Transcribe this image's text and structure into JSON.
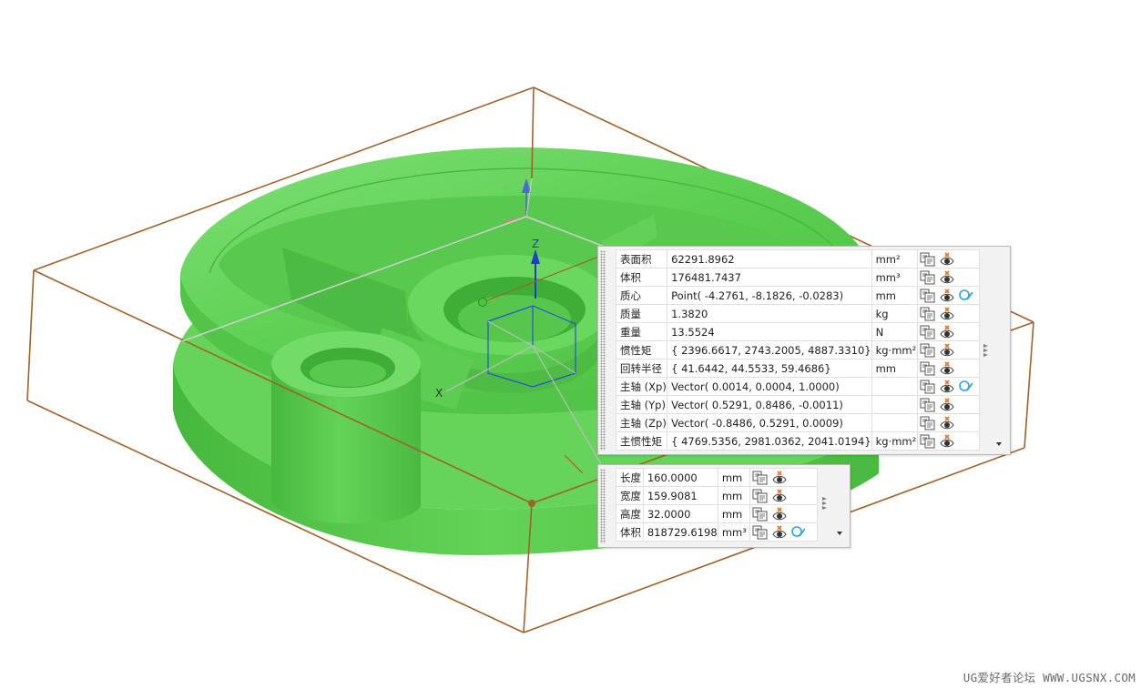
{
  "mass_properties": {
    "rows": [
      {
        "label": "表面积",
        "value": "62291.8962",
        "unit": "mm²",
        "filter": false
      },
      {
        "label": "体积",
        "value": "176481.7437",
        "unit": "mm³",
        "filter": false
      },
      {
        "label": "质心",
        "value": "Point( -4.2761, -8.1826, -0.0283)",
        "unit": "mm",
        "filter": true
      },
      {
        "label": "质量",
        "value": "1.3820",
        "unit": "kg",
        "filter": false
      },
      {
        "label": "重量",
        "value": "13.5524",
        "unit": "N",
        "filter": false
      },
      {
        "label": "惯性矩",
        "value": "{ 2396.6617, 2743.2005, 4887.3310}",
        "unit": "kg·mm²",
        "filter": false
      },
      {
        "label": "回转半径",
        "value": "{ 41.6442, 44.5533, 59.4686}",
        "unit": "mm",
        "filter": false
      },
      {
        "label": "主轴 (Xp)",
        "value": "Vector( 0.0014, 0.0004, 1.0000)",
        "unit": "",
        "filter": true
      },
      {
        "label": "主轴 (Yp)",
        "value": "Vector( 0.5291, 0.8486, -0.0011)",
        "unit": "",
        "filter": false
      },
      {
        "label": "主轴 (Zp)",
        "value": "Vector( -0.8486, 0.5291, 0.0009)",
        "unit": "",
        "filter": false
      },
      {
        "label": "主惯性矩",
        "value": "{ 4769.5356, 2981.0362, 2041.0194}",
        "unit": "kg·mm²",
        "filter": false
      }
    ]
  },
  "bounding_box": {
    "rows": [
      {
        "label": "长度",
        "value": "160.0000",
        "unit": "mm",
        "filter": false
      },
      {
        "label": "宽度",
        "value": "159.9081",
        "unit": "mm",
        "filter": false
      },
      {
        "label": "高度",
        "value": "32.0000",
        "unit": "mm",
        "filter": false
      },
      {
        "label": "体积",
        "value": "818729.6198",
        "unit": "mm³",
        "filter": true
      }
    ]
  },
  "axes": {
    "z_label": "Z",
    "x_label": "X"
  },
  "colors": {
    "model": "#5fcf55",
    "box": "#a0622a",
    "axis_blue": "#2b4fd8",
    "filter_icon": "#2aa3e0"
  },
  "icons": {
    "copy": "copy-to-clipboard-icon",
    "show": "show-hide-eye-icon",
    "filter": "filter-icon"
  },
  "watermark": "UG爱好者论坛 WWW.UGSNX.COM"
}
